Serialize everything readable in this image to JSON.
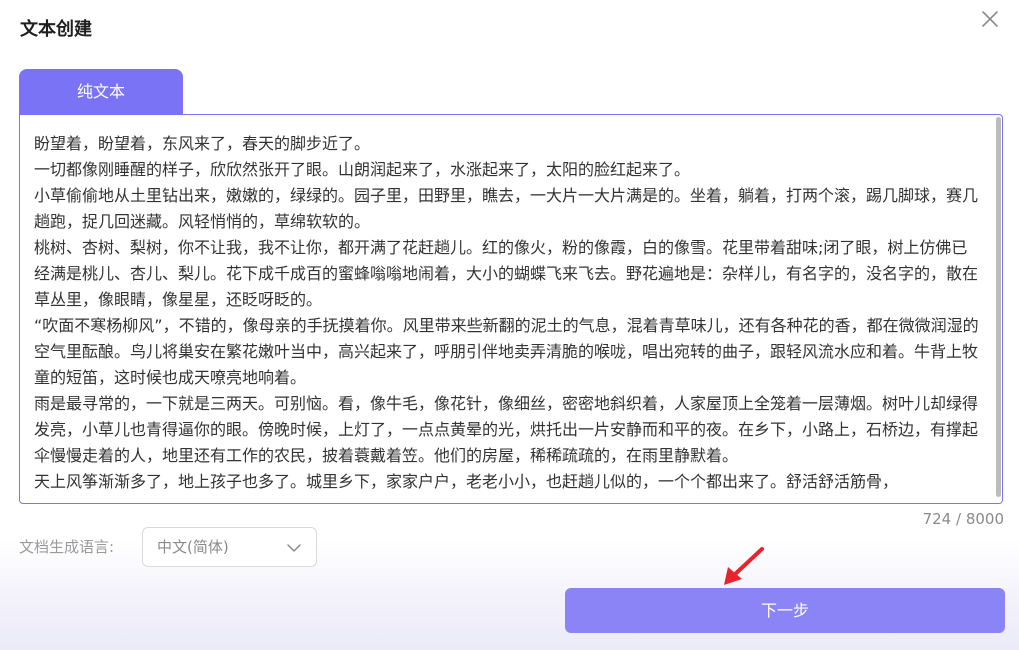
{
  "dialog": {
    "title": "文本创建",
    "close_icon": "close-icon"
  },
  "tabs": [
    {
      "label": "纯文本",
      "active": true
    }
  ],
  "editor": {
    "content": "盼望着，盼望着，东风来了，春天的脚步近了。\n一切都像刚睡醒的样子，欣欣然张开了眼。山朗润起来了，水涨起来了，太阳的脸红起来了。\n小草偷偷地从土里钻出来，嫩嫩的，绿绿的。园子里，田野里，瞧去，一大片一大片满是的。坐着，躺着，打两个滚，踢几脚球，赛几趟跑，捉几回迷藏。风轻悄悄的，草绵软软的。\n桃树、杏树、梨树，你不让我，我不让你，都开满了花赶趟儿。红的像火，粉的像霞，白的像雪。花里带着甜味;闭了眼，树上仿佛已经满是桃儿、杏儿、梨儿。花下成千成百的蜜蜂嗡嗡地闹着，大小的蝴蝶飞来飞去。野花遍地是：杂样儿，有名字的，没名字的，散在草丛里，像眼睛，像星星，还眨呀眨的。\n“吹面不寒杨柳风”，不错的，像母亲的手抚摸着你。风里带来些新翻的泥土的气息，混着青草味儿，还有各种花的香，都在微微润湿的空气里酝酿。鸟儿将巢安在繁花嫩叶当中，高兴起来了，呼朋引伴地卖弄清脆的喉咙，唱出宛转的曲子，跟轻风流水应和着。牛背上牧童的短笛，这时候也成天嘹亮地响着。\n雨是最寻常的，一下就是三两天。可别恼。看，像牛毛，像花针，像细丝，密密地斜织着，人家屋顶上全笼着一层薄烟。树叶儿却绿得发亮，小草儿也青得逼你的眼。傍晚时候，上灯了，一点点黄晕的光，烘托出一片安静而和平的夜。在乡下，小路上，石桥边，有撑起伞慢慢走着的人，地里还有工作的农民，披着蓑戴着笠。他们的房屋，稀稀疏疏的，在雨里静默着。\n天上风筝渐渐多了，地上孩子也多了。城里乡下，家家户户，老老小小，也赶趟儿似的，一个个都出来了。舒活舒活筋骨，",
    "counter": "724 / 8000"
  },
  "language": {
    "label": "文档生成语言:",
    "selected": "中文(简体)"
  },
  "actions": {
    "next_label": "下一步"
  },
  "colors": {
    "accent": "#7b73f5",
    "button": "#8b84f6",
    "annotation_arrow": "#e8232b"
  }
}
